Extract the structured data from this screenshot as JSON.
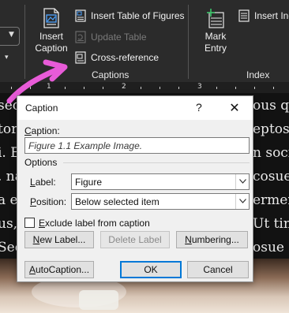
{
  "ribbon": {
    "insert_caption": {
      "line1": "Insert",
      "line2": "Caption",
      "icon": "insert-caption-icon"
    },
    "insert_table_of_figures": {
      "label": "Insert Table of Figures",
      "icon": "table-of-figures-icon"
    },
    "update_table": {
      "label": "Update Table",
      "icon": "update-table-icon"
    },
    "cross_reference": {
      "label": "Cross-reference",
      "icon": "cross-reference-icon"
    },
    "captions_group": "Captions",
    "mark_entry": {
      "line1": "Mark",
      "line2": "Entry",
      "icon": "mark-entry-icon"
    },
    "insert_index": {
      "label": "Insert Inc",
      "icon": "insert-index-icon"
    },
    "index_group": "Index"
  },
  "ruler": {
    "labels": [
      "1",
      "2",
      "3"
    ]
  },
  "document": {
    "lines": [
      {
        "left": "sec",
        "right": "ous q"
      },
      {
        "left": "tor",
        "right": "eptos"
      },
      {
        "left": "i. E",
        "right": "n soci"
      },
      {
        "left": ". na",
        "right": "cosue"
      },
      {
        "left": "a e",
        "right": "ermen"
      },
      {
        "left": "us,",
        "right": "Ut tin"
      },
      {
        "left": "Sec",
        "right": "osue"
      }
    ]
  },
  "dialog": {
    "title": "Caption",
    "help": "?",
    "close": "✕",
    "caption_label": "Caption:",
    "caption_value": "Figure 1.1 Example Image.",
    "options_heading": "Options",
    "label_label": "Label:",
    "label_value": "Figure",
    "position_label": "Position:",
    "position_value": "Below selected item",
    "exclude_label": "Exclude label from caption",
    "exclude_checked": false,
    "buttons": {
      "new_label": "New Label...",
      "delete_label": "Delete Label",
      "numbering": "Numbering...",
      "autocaption": "AutoCaption...",
      "ok": "OK",
      "cancel": "Cancel"
    }
  },
  "colors": {
    "ribbon_bg": "#2b2b2b",
    "annotation": "#e85bd8",
    "dialog_bg": "#f0f0f0",
    "default_button_border": "#0078d7"
  }
}
